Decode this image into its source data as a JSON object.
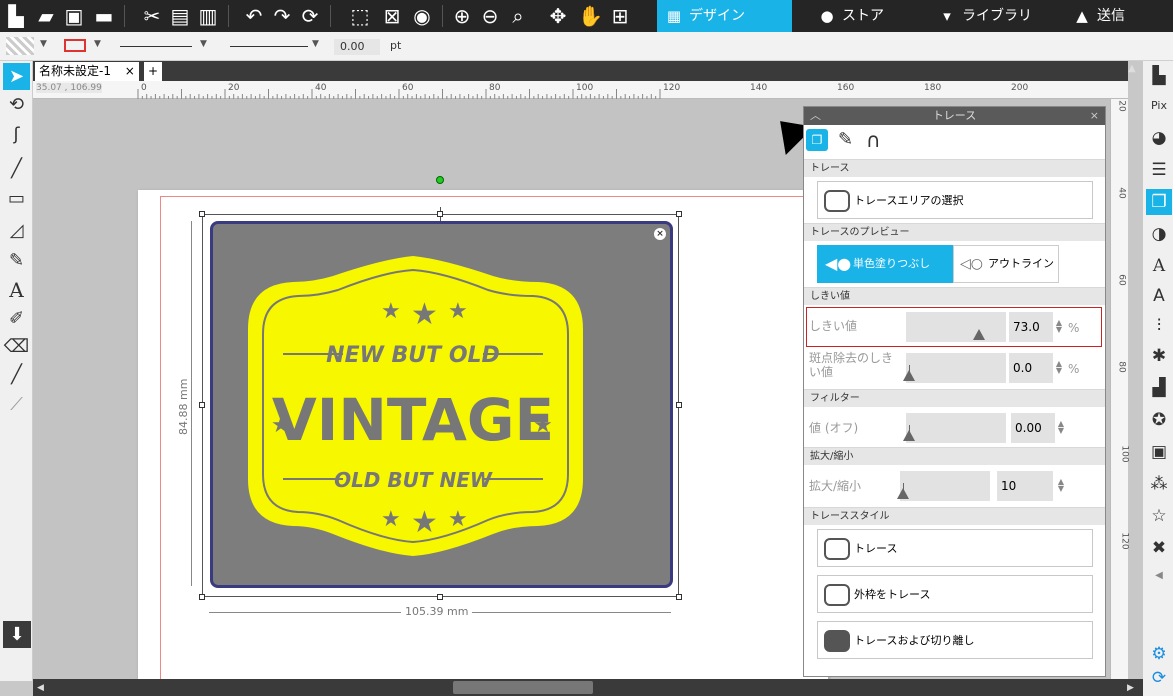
{
  "toolbar": {
    "design_tab": "デザイン",
    "store_tab": "ストア",
    "library_tab": "ライブラリ",
    "send_tab": "送信",
    "line_width_value": "0.00",
    "line_width_unit": "pt"
  },
  "document": {
    "tab_label": "名称未設定-1",
    "close_glyph": "×",
    "add_glyph": "+",
    "cursor_readout": "35.07 , 106.99"
  },
  "ruler": {
    "h_ticks": [
      "0",
      "20",
      "40",
      "60",
      "80",
      "100",
      "120",
      "140",
      "160",
      "180",
      "200"
    ],
    "v_ticks": [
      "20",
      "40",
      "60",
      "80",
      "100",
      "120"
    ]
  },
  "selection": {
    "height_label": "84.88 mm",
    "width_label": "105.39 mm"
  },
  "artwork": {
    "top_text": "NEW BUT OLD",
    "main_text": "VINTAGE",
    "bottom_text": "OLD BUT NEW",
    "fill_color": "#f7f700",
    "background_color": "#7d7d7d",
    "outline_color": "#3a3a80"
  },
  "trace_panel": {
    "title": "トレース",
    "section_trace": "トレース",
    "select_area_button": "トレースエリアの選択",
    "section_preview": "トレースのプレビュー",
    "preview_fill": "単色塗りつぶし",
    "preview_outline": "アウトライン",
    "section_threshold": "しきい値",
    "threshold_label": "しきい値",
    "threshold_value": "73.0",
    "threshold_unit": "%",
    "threshold_level": 0.73,
    "noise_label": "斑点除去のしきい値",
    "noise_value": "0.0",
    "noise_unit": "%",
    "section_filter": "フィルター",
    "filter_label": "値 (オフ)",
    "filter_value": "0.00",
    "section_scale": "拡大/縮小",
    "scale_label": "拡大/縮小",
    "scale_value": "10",
    "section_style": "トレーススタイル",
    "style_trace": "トレース",
    "style_outer": "外枠をトレース",
    "style_detach": "トレースおよび切り離し",
    "accent_color": "#1ab3e8",
    "highlight_color": "#cc2222"
  }
}
